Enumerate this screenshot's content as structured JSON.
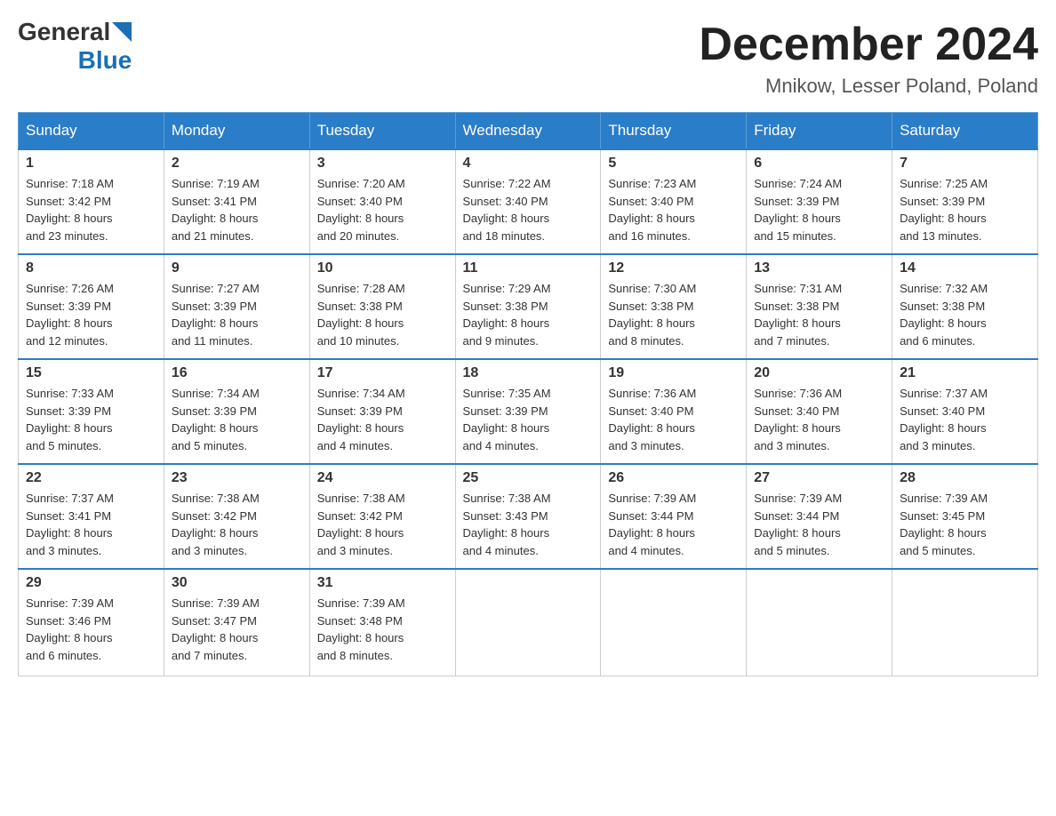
{
  "header": {
    "logo_general": "General",
    "logo_blue": "Blue",
    "title": "December 2024",
    "subtitle": "Mnikow, Lesser Poland, Poland"
  },
  "columns": [
    "Sunday",
    "Monday",
    "Tuesday",
    "Wednesday",
    "Thursday",
    "Friday",
    "Saturday"
  ],
  "weeks": [
    [
      {
        "day": "1",
        "sunrise": "7:18 AM",
        "sunset": "3:42 PM",
        "daylight": "8 hours and 23 minutes."
      },
      {
        "day": "2",
        "sunrise": "7:19 AM",
        "sunset": "3:41 PM",
        "daylight": "8 hours and 21 minutes."
      },
      {
        "day": "3",
        "sunrise": "7:20 AM",
        "sunset": "3:40 PM",
        "daylight": "8 hours and 20 minutes."
      },
      {
        "day": "4",
        "sunrise": "7:22 AM",
        "sunset": "3:40 PM",
        "daylight": "8 hours and 18 minutes."
      },
      {
        "day": "5",
        "sunrise": "7:23 AM",
        "sunset": "3:40 PM",
        "daylight": "8 hours and 16 minutes."
      },
      {
        "day": "6",
        "sunrise": "7:24 AM",
        "sunset": "3:39 PM",
        "daylight": "8 hours and 15 minutes."
      },
      {
        "day": "7",
        "sunrise": "7:25 AM",
        "sunset": "3:39 PM",
        "daylight": "8 hours and 13 minutes."
      }
    ],
    [
      {
        "day": "8",
        "sunrise": "7:26 AM",
        "sunset": "3:39 PM",
        "daylight": "8 hours and 12 minutes."
      },
      {
        "day": "9",
        "sunrise": "7:27 AM",
        "sunset": "3:39 PM",
        "daylight": "8 hours and 11 minutes."
      },
      {
        "day": "10",
        "sunrise": "7:28 AM",
        "sunset": "3:38 PM",
        "daylight": "8 hours and 10 minutes."
      },
      {
        "day": "11",
        "sunrise": "7:29 AM",
        "sunset": "3:38 PM",
        "daylight": "8 hours and 9 minutes."
      },
      {
        "day": "12",
        "sunrise": "7:30 AM",
        "sunset": "3:38 PM",
        "daylight": "8 hours and 8 minutes."
      },
      {
        "day": "13",
        "sunrise": "7:31 AM",
        "sunset": "3:38 PM",
        "daylight": "8 hours and 7 minutes."
      },
      {
        "day": "14",
        "sunrise": "7:32 AM",
        "sunset": "3:38 PM",
        "daylight": "8 hours and 6 minutes."
      }
    ],
    [
      {
        "day": "15",
        "sunrise": "7:33 AM",
        "sunset": "3:39 PM",
        "daylight": "8 hours and 5 minutes."
      },
      {
        "day": "16",
        "sunrise": "7:34 AM",
        "sunset": "3:39 PM",
        "daylight": "8 hours and 5 minutes."
      },
      {
        "day": "17",
        "sunrise": "7:34 AM",
        "sunset": "3:39 PM",
        "daylight": "8 hours and 4 minutes."
      },
      {
        "day": "18",
        "sunrise": "7:35 AM",
        "sunset": "3:39 PM",
        "daylight": "8 hours and 4 minutes."
      },
      {
        "day": "19",
        "sunrise": "7:36 AM",
        "sunset": "3:40 PM",
        "daylight": "8 hours and 3 minutes."
      },
      {
        "day": "20",
        "sunrise": "7:36 AM",
        "sunset": "3:40 PM",
        "daylight": "8 hours and 3 minutes."
      },
      {
        "day": "21",
        "sunrise": "7:37 AM",
        "sunset": "3:40 PM",
        "daylight": "8 hours and 3 minutes."
      }
    ],
    [
      {
        "day": "22",
        "sunrise": "7:37 AM",
        "sunset": "3:41 PM",
        "daylight": "8 hours and 3 minutes."
      },
      {
        "day": "23",
        "sunrise": "7:38 AM",
        "sunset": "3:42 PM",
        "daylight": "8 hours and 3 minutes."
      },
      {
        "day": "24",
        "sunrise": "7:38 AM",
        "sunset": "3:42 PM",
        "daylight": "8 hours and 3 minutes."
      },
      {
        "day": "25",
        "sunrise": "7:38 AM",
        "sunset": "3:43 PM",
        "daylight": "8 hours and 4 minutes."
      },
      {
        "day": "26",
        "sunrise": "7:39 AM",
        "sunset": "3:44 PM",
        "daylight": "8 hours and 4 minutes."
      },
      {
        "day": "27",
        "sunrise": "7:39 AM",
        "sunset": "3:44 PM",
        "daylight": "8 hours and 5 minutes."
      },
      {
        "day": "28",
        "sunrise": "7:39 AM",
        "sunset": "3:45 PM",
        "daylight": "8 hours and 5 minutes."
      }
    ],
    [
      {
        "day": "29",
        "sunrise": "7:39 AM",
        "sunset": "3:46 PM",
        "daylight": "8 hours and 6 minutes."
      },
      {
        "day": "30",
        "sunrise": "7:39 AM",
        "sunset": "3:47 PM",
        "daylight": "8 hours and 7 minutes."
      },
      {
        "day": "31",
        "sunrise": "7:39 AM",
        "sunset": "3:48 PM",
        "daylight": "8 hours and 8 minutes."
      },
      null,
      null,
      null,
      null
    ]
  ],
  "labels": {
    "sunrise": "Sunrise:",
    "sunset": "Sunset:",
    "daylight": "Daylight:"
  }
}
